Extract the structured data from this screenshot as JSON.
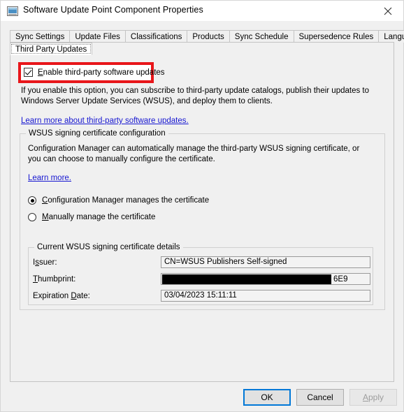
{
  "window": {
    "title": "Software Update Point Component Properties",
    "icon": "window-properties-icon",
    "close_label": "✕"
  },
  "tabs": {
    "row1": [
      {
        "label": "Sync Settings",
        "selected": false
      },
      {
        "label": "Update Files",
        "selected": false
      },
      {
        "label": "Classifications",
        "selected": false
      },
      {
        "label": "Products",
        "selected": false
      },
      {
        "label": "Sync Schedule",
        "selected": false
      },
      {
        "label": "Supersedence Rules",
        "selected": false
      },
      {
        "label": "Languages",
        "selected": false
      }
    ],
    "row2": [
      {
        "label": "Third Party Updates",
        "selected": true
      }
    ]
  },
  "main": {
    "enable_checkbox": {
      "label": "Enable third-party software updates",
      "accelerator": "E",
      "checked": true,
      "highlighted": true,
      "highlight_color": "#e8161a"
    },
    "intro_paragraph": "If you enable this option, you can subscribe to third-party update catalogs, publish their updates to Windows Server Update Services (WSUS), and deploy them to clients.",
    "main_link": "Learn more about third-party software updates.",
    "wsus_group": {
      "title": "WSUS signing certificate configuration",
      "description": "Configuration Manager can automatically manage the third-party WSUS signing certificate, or you can choose to manually configure the certificate.",
      "learn_more_link": "Learn more.",
      "radios": [
        {
          "label": "Configuration Manager manages the certificate",
          "accelerator": "C",
          "selected": true
        },
        {
          "label": "Manually manage the certificate",
          "accelerator": "M",
          "selected": false
        }
      ],
      "cert_group": {
        "title": "Current WSUS signing certificate details",
        "rows": [
          {
            "label": "Issuer:",
            "accelerator": "s",
            "value": "CN=WSUS Publishers Self-signed",
            "redacted": false
          },
          {
            "label": "Thumbprint:",
            "accelerator": "T",
            "value": "6E9",
            "redacted": true
          },
          {
            "label": "Expiration Date:",
            "accelerator": "D",
            "value": "03/04/2023 15:11:11",
            "redacted": false
          }
        ]
      }
    }
  },
  "buttons": {
    "ok": "OK",
    "cancel": "Cancel",
    "apply": "Apply",
    "apply_enabled": false,
    "default_button": "OK",
    "focus_color": "#0078d7"
  }
}
